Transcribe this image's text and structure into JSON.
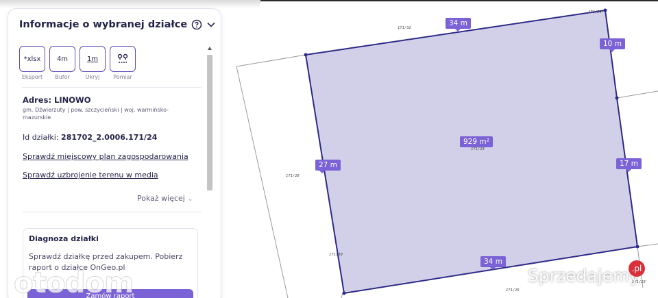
{
  "panel": {
    "title": "Informacje o wybranej działce",
    "tools": [
      {
        "icon_text": "*xlsx",
        "label": "Eksport"
      },
      {
        "icon_text": "4m",
        "label": "Bufor"
      },
      {
        "icon_text": "1m",
        "label": "Ukryj"
      },
      {
        "icon_text": "",
        "label": "Pomiar"
      }
    ],
    "address_label": "Adres: LINOWO",
    "address_sub": "gm. Dźwierzuty | pow. szczycieński | woj. warmińsko-mazurskie",
    "id_prefix": "Id działki:",
    "id_value": "281702_2.0006.171/24",
    "link_plan": "Sprawdź miejscowy plan zagospodarowania",
    "link_media": "Sprawdź uzbrojenie terenu w media",
    "more_label": "Pokaż więcej",
    "diagnosis_title": "Diagnoza działki",
    "diagnosis_text": "Sprawdź działkę przed zakupem. Pobierz raport o działce OnGeo.pl",
    "diagnosis_button": "Zamów raport"
  },
  "map": {
    "dimensions": {
      "top": "34 m",
      "top_right": "10 m",
      "right": "17 m",
      "left": "27 m",
      "bottom": "34 m"
    },
    "area": "929 m²",
    "parcel_ids": {
      "selected": "171/24",
      "top": "171/32",
      "top_corner": "171/24",
      "left": "171/28",
      "bottom_left": "171/30",
      "bottom": "171/25",
      "bottom_right": "171/23"
    },
    "colors": {
      "parcel_fill": "#d2d0e8",
      "parcel_stroke": "#2c2a86",
      "label_bg": "#7b62d6"
    }
  },
  "watermark": {
    "site": "Sprzedajemy",
    "badge": ".pl"
  }
}
